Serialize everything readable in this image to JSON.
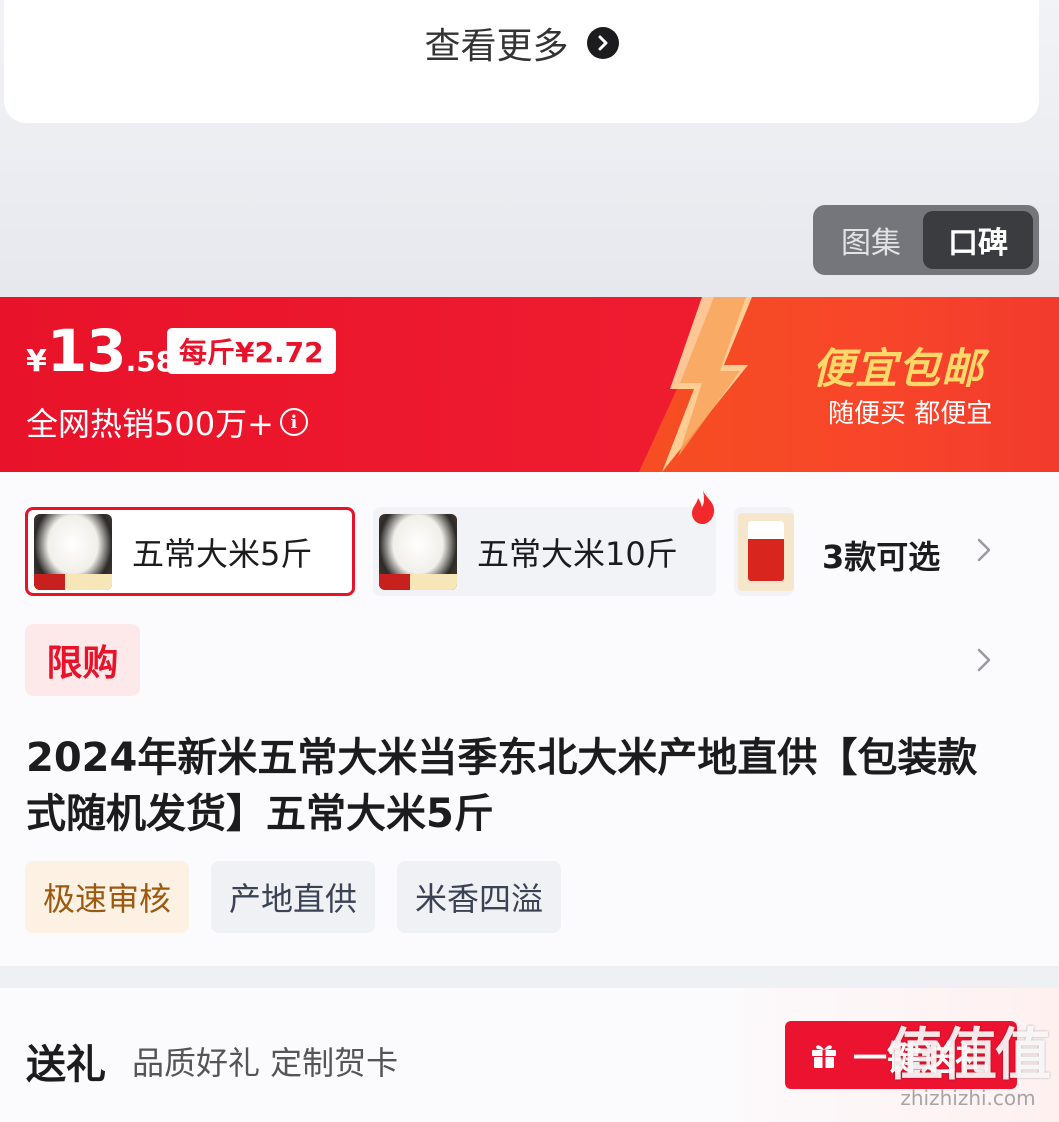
{
  "top": {
    "view_more_label": "查看更多",
    "media_tabs": [
      "图集",
      "口碑"
    ],
    "active_tab": "口碑"
  },
  "price_banner": {
    "currency": "¥",
    "price_integer": "13",
    "price_decimal": ".58",
    "unit_price": "每斤¥2.72",
    "sales_text": "全网热销500万+",
    "promo_title": "便宜包邮",
    "promo_subtitle": "随便买 都便宜"
  },
  "variants": [
    {
      "label": "五常大米5斤",
      "selected": true,
      "hot": false
    },
    {
      "label": "五常大米10斤",
      "selected": false,
      "hot": true
    },
    {
      "label": "",
      "selected": false,
      "hot": false
    }
  ],
  "more_variants_label": "3款可选",
  "limit_tag": "限购",
  "product_title": "2024年新米五常大米当季东北大米产地直供【包装款式随机发货】五常大米5斤",
  "tags": [
    "极速审核",
    "产地直供",
    "米香四溢"
  ],
  "gift": {
    "title": "送礼",
    "subtitle": "品质好礼 定制贺卡",
    "button_label": "一键送礼"
  },
  "watermark": {
    "main": "值值值",
    "sub": "zhizhizhi.com"
  },
  "colors": {
    "brand_red": "#e8132a",
    "promo_orange": "#f64e22",
    "promo_gold": "#ffd86a"
  }
}
